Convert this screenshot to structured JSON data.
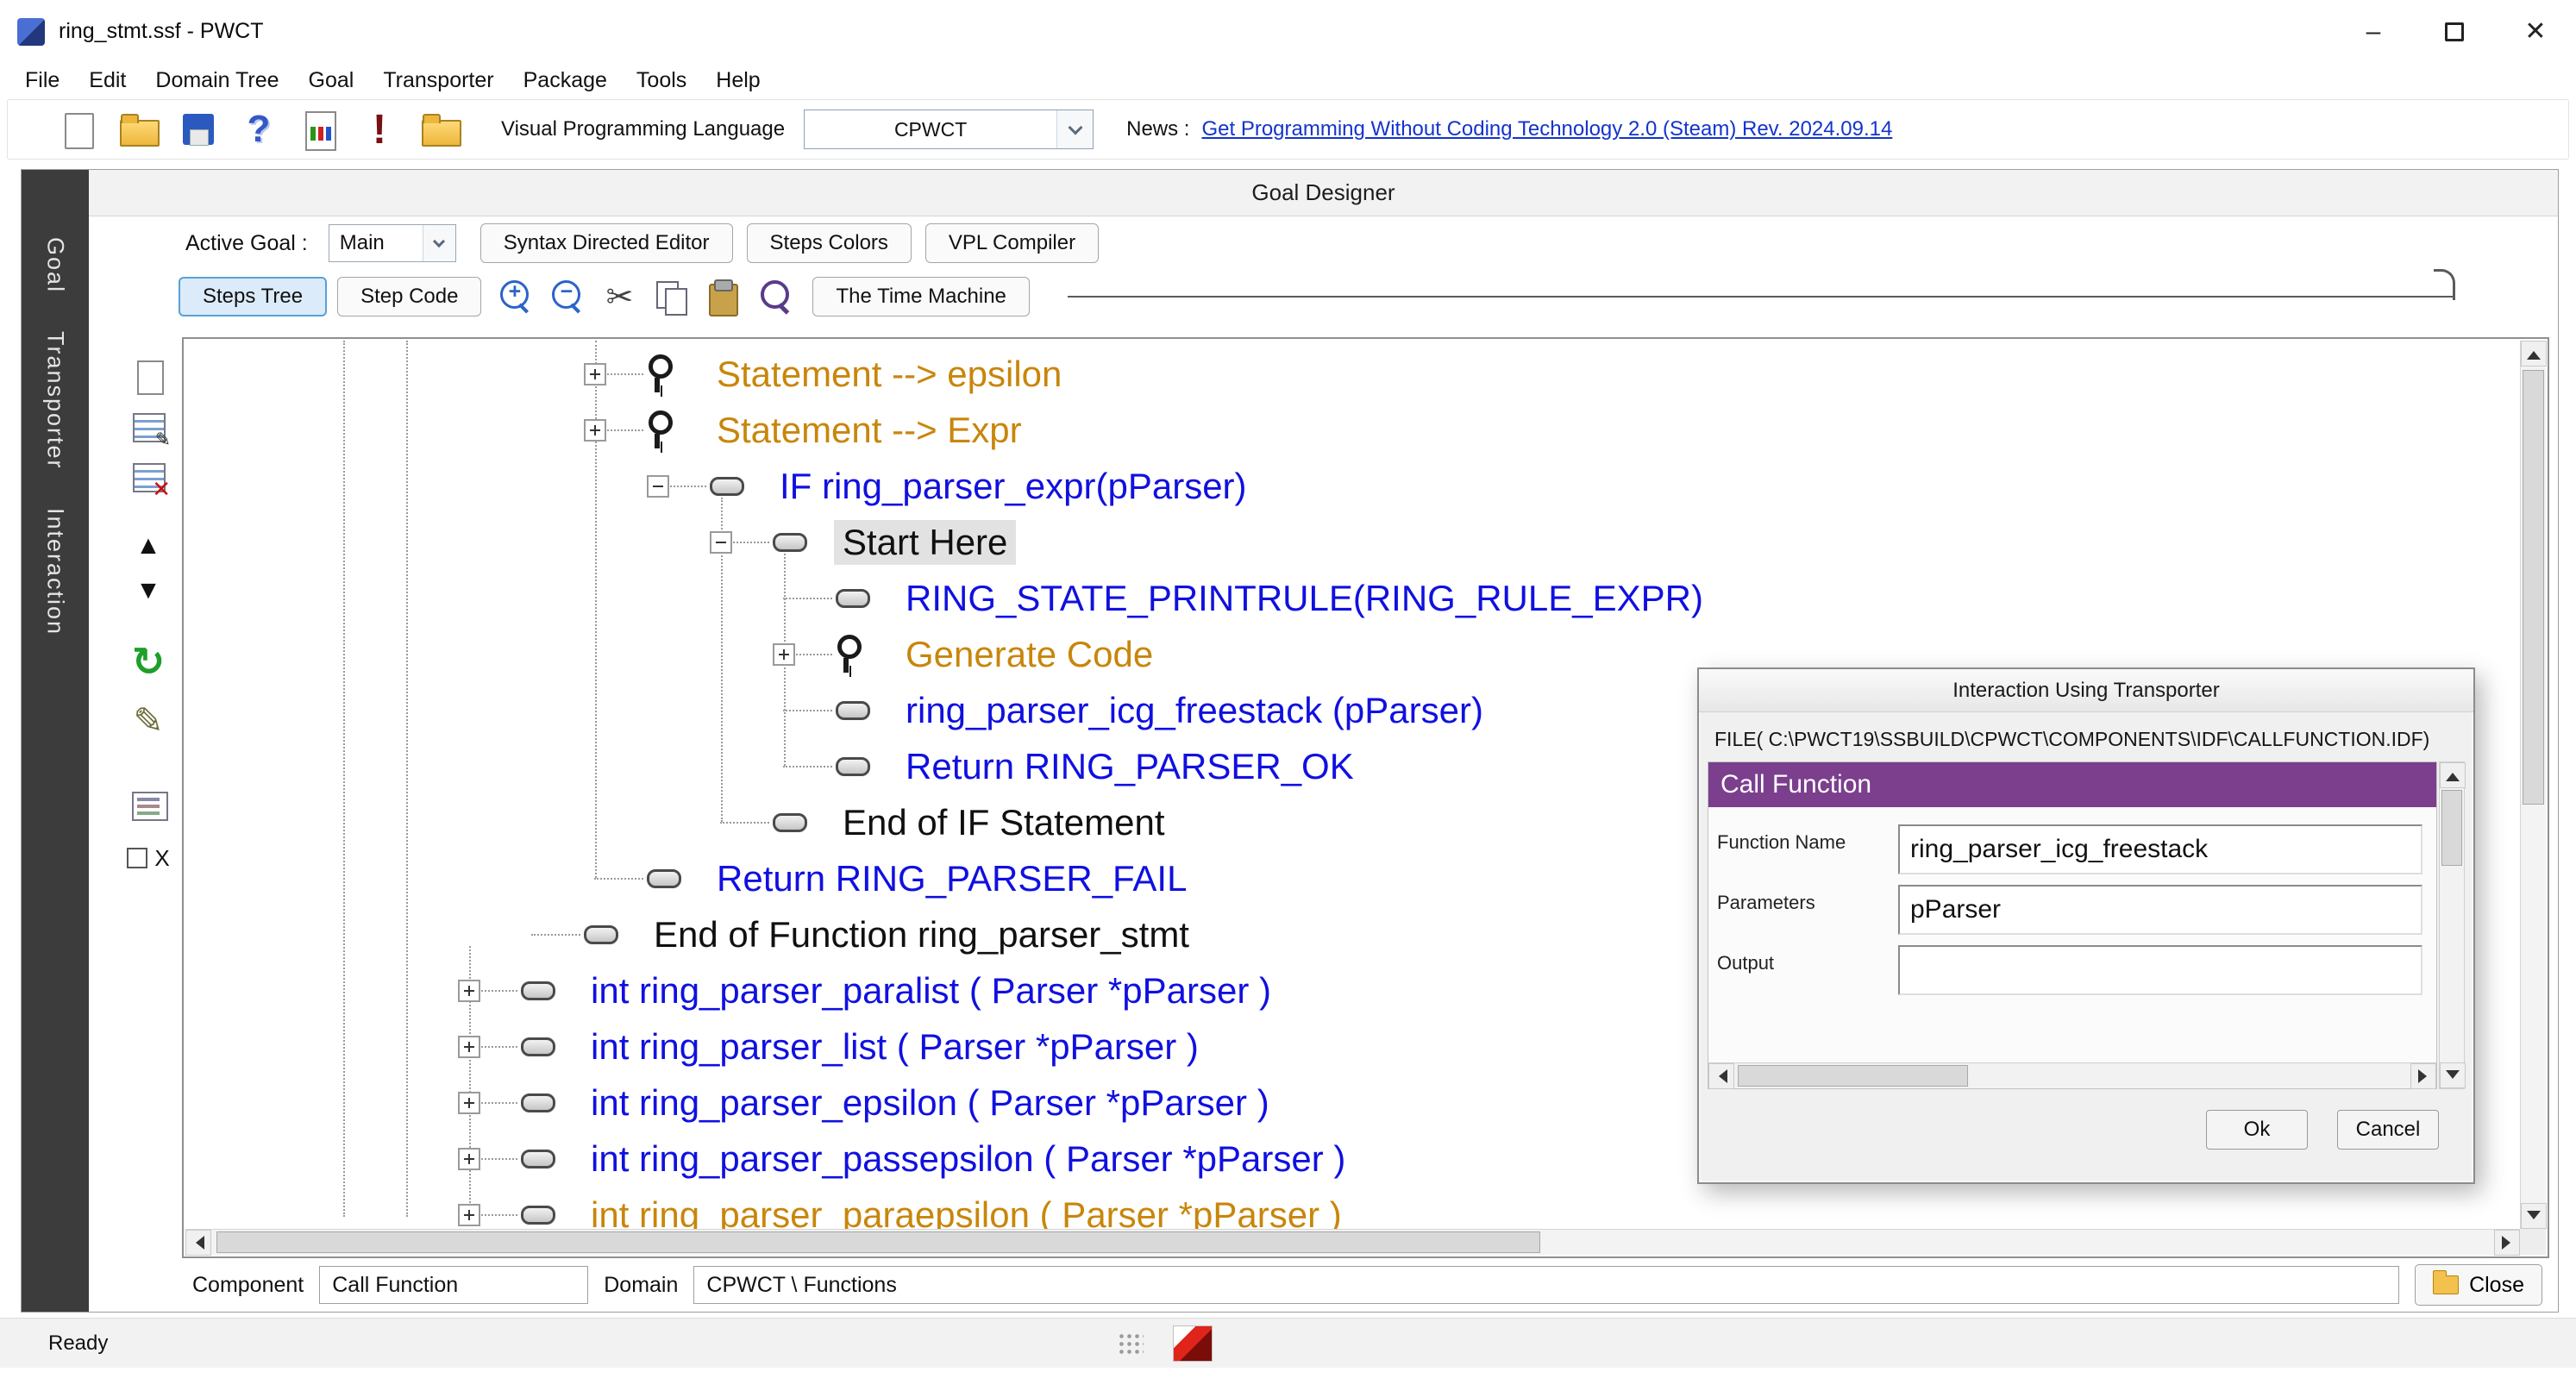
{
  "window": {
    "title": "ring_stmt.ssf - PWCT",
    "minimize_glyph": "–",
    "close_glyph": "✕"
  },
  "menubar": {
    "items": [
      "File",
      "Edit",
      "Domain Tree",
      "Goal",
      "Transporter",
      "Package",
      "Tools",
      "Help"
    ]
  },
  "toolbar": {
    "icons": [
      "new-file-icon",
      "open-file-icon",
      "save-file-icon",
      "help-icon",
      "report-icon",
      "run-icon",
      "package-icon"
    ],
    "vpl_label": "Visual Programming Language",
    "vpl_value": "CPWCT",
    "news_label": "News :",
    "news_link_text": "Get Programming Without Coding Technology 2.0 (Steam) Rev. 2024.09.14"
  },
  "side_tabs": [
    "Goal",
    "Transporter",
    "Interaction"
  ],
  "goal_designer": {
    "title": "Goal Designer",
    "active_goal_label": "Active Goal :",
    "active_goal_value": "Main",
    "header_buttons": [
      "Syntax Directed Editor",
      "Steps Colors",
      "VPL Compiler"
    ],
    "view_tabs": [
      {
        "label": "Steps Tree",
        "active": true
      },
      {
        "label": "Step Code",
        "active": false
      }
    ],
    "edit_icons": [
      "zoom-in-icon",
      "zoom-out-icon",
      "cut-icon",
      "copy-icon",
      "paste-icon",
      "find-icon"
    ],
    "time_machine_label": "The Time Machine"
  },
  "step_toolbox_icons": [
    "new-step-icon",
    "edit-table-icon",
    "delete-table-icon",
    "move-up-icon",
    "move-down-icon",
    "refresh-icon",
    "edit-interaction-icon",
    "properties-icon",
    "checkbox-x-icon"
  ],
  "tree": {
    "rows": [
      {
        "text": "Statement --> epsilon",
        "color": "#C8860B",
        "indent": 6,
        "expander": "plus",
        "icon": "key"
      },
      {
        "text": "Statement --> Expr",
        "color": "#C8860B",
        "indent": 6,
        "expander": "plus",
        "icon": "key"
      },
      {
        "text": "IF ring_parser_expr(pParser)",
        "color": "#1010E0",
        "indent": 7,
        "expander": "minus",
        "icon": "step"
      },
      {
        "text": "Start Here",
        "color": "#101010",
        "indent": 8,
        "expander": "minus",
        "icon": "step",
        "selected": true
      },
      {
        "text": "RING_STATE_PRINTRULE(RING_RULE_EXPR)",
        "color": "#1010E0",
        "indent": 9,
        "expander": "none",
        "icon": "step"
      },
      {
        "text": "Generate Code",
        "color": "#C8860B",
        "indent": 9,
        "expander": "plus",
        "icon": "key"
      },
      {
        "text": "ring_parser_icg_freestack (pParser)",
        "color": "#1010E0",
        "indent": 9,
        "expander": "none",
        "icon": "step"
      },
      {
        "text": "Return RING_PARSER_OK",
        "color": "#1010E0",
        "indent": 9,
        "expander": "none",
        "icon": "step"
      },
      {
        "text": "End of IF Statement",
        "color": "#101010",
        "indent": 8,
        "expander": "none",
        "icon": "step"
      },
      {
        "text": "Return RING_PARSER_FAIL",
        "color": "#1010E0",
        "indent": 6,
        "expander": "none",
        "icon": "step"
      },
      {
        "text": "End of Function ring_parser_stmt",
        "color": "#101010",
        "indent": 5,
        "expander": "none",
        "icon": "step"
      },
      {
        "text": "int ring_parser_paralist ( Parser *pParser )",
        "color": "#1010E0",
        "indent": 4,
        "expander": "plus",
        "icon": "step"
      },
      {
        "text": "int ring_parser_list ( Parser *pParser )",
        "color": "#1010E0",
        "indent": 4,
        "expander": "plus",
        "icon": "step"
      },
      {
        "text": "int ring_parser_epsilon ( Parser *pParser )",
        "color": "#1010E0",
        "indent": 4,
        "expander": "plus",
        "icon": "step"
      },
      {
        "text": "int ring_parser_passepsilon ( Parser *pParser )",
        "color": "#1010E0",
        "indent": 4,
        "expander": "plus",
        "icon": "step"
      },
      {
        "text": "int ring_parser_paraepsilon ( Parser *pParser )",
        "color": "#C8860B",
        "indent": 4,
        "expander": "plus",
        "icon": "step",
        "clipped": true
      }
    ]
  },
  "dialog": {
    "title": "Interaction Using Transporter",
    "file_line": "FILE( C:\\PWCT19\\SSBUILD\\CPWCT\\COMPONENTS\\IDF\\CALLFUNCTION.IDF)",
    "section_header": "Call Function",
    "fields": [
      {
        "label": "Function Name",
        "value": "ring_parser_icg_freestack"
      },
      {
        "label": "Parameters",
        "value": "pParser"
      },
      {
        "label": "Output",
        "value": ""
      }
    ],
    "ok_label": "Ok",
    "cancel_label": "Cancel"
  },
  "bottom_bar": {
    "component_label": "Component",
    "component_value": "Call Function",
    "domain_label": "Domain",
    "domain_value": "CPWCT \\ Functions",
    "close_label": "Close"
  },
  "status_bar": {
    "text": "Ready"
  },
  "colors": {
    "tree_blue": "#1010E0",
    "tree_orange": "#C8860B",
    "dialog_purple": "#7B3F8E",
    "link_blue": "#1334CC",
    "active_tab_bg": "#DBEBFA",
    "active_tab_border": "#59A0D8",
    "sidebar_bg": "#3C3C3C"
  }
}
